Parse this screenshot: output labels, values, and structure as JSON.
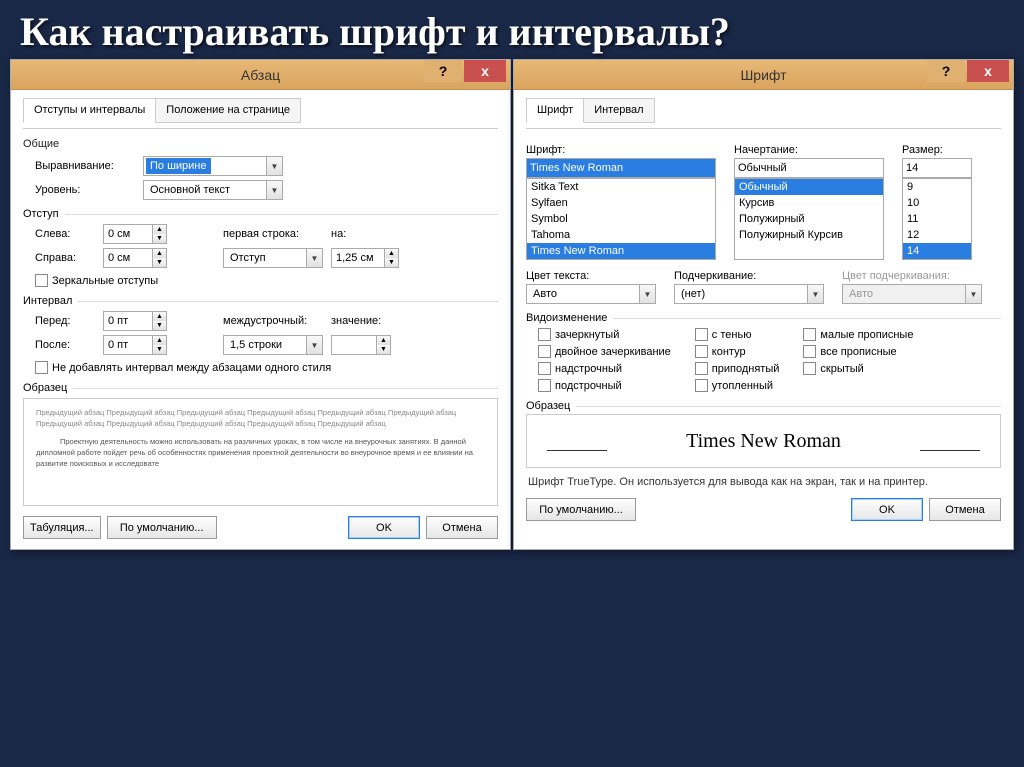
{
  "slide_title": "Как настраивать шрифт и интервалы?",
  "paragraph": {
    "title": "Абзац",
    "help": "?",
    "close": "x",
    "tabs": {
      "t1": "Отступы и интервалы",
      "t2": "Положение на странице"
    },
    "g_general": "Общие",
    "align_label": "Выравнивание:",
    "align_value": "По ширине",
    "level_label": "Уровень:",
    "level_value": "Основной текст",
    "g_indent": "Отступ",
    "left_label": "Слева:",
    "left_value": "0 см",
    "right_label": "Справа:",
    "right_value": "0 см",
    "first_label": "первая строка:",
    "first_value": "Отступ",
    "by_label": "на:",
    "by_value": "1,25 см",
    "mirror": "Зеркальные отступы",
    "g_spacing": "Интервал",
    "before_label": "Перед:",
    "before_value": "0 пт",
    "after_label": "После:",
    "after_value": "0 пт",
    "line_label": "междустрочный:",
    "line_value": "1,5 строки",
    "val_label": "значение:",
    "val_value": "",
    "nospace": "Не добавлять интервал между абзацами одного стиля",
    "g_preview": "Образец",
    "preview_text_1": "Предыдущий абзац Предыдущий абзац Предыдущий абзац Предыдущий абзац Предыдущий абзац Предыдущий абзац Предыдущий абзац Предыдущий абзац Предыдущий абзац Предыдущий абзац Предыдущий абзац",
    "preview_text_2": "Проектную деятельность можно использовать на различных уроках, в том числе на внеурочных занятиях. В данной дипломной работе пойдет речь об особенностях применения проектной деятельности во внеурочное время и ее влиянии на развитие поисковых и исследовате",
    "btn_tabs": "Табуляция...",
    "btn_default": "По умолчанию...",
    "btn_ok": "OK",
    "btn_cancel": "Отмена"
  },
  "font": {
    "title": "Шрифт",
    "help": "?",
    "close": "x",
    "tabs": {
      "t1": "Шрифт",
      "t2": "Интервал"
    },
    "font_label": "Шрифт:",
    "font_value": "Times New Roman",
    "font_list": [
      "Sitka Text",
      "Sylfaen",
      "Symbol",
      "Tahoma",
      "Times New Roman"
    ],
    "style_label": "Начертание:",
    "style_value": "Обычный",
    "style_list": [
      "Обычный",
      "Курсив",
      "Полужирный",
      "Полужирный Курсив"
    ],
    "size_label": "Размер:",
    "size_value": "14",
    "size_list": [
      "9",
      "10",
      "11",
      "12",
      "14"
    ],
    "color_label": "Цвет текста:",
    "color_value": "Авто",
    "underline_label": "Подчеркивание:",
    "underline_value": "(нет)",
    "undercolor_label": "Цвет подчеркивания:",
    "undercolor_value": "Авто",
    "g_effects": "Видоизменение",
    "eff": {
      "strike": "зачеркнутый",
      "dblstrike": "двойное зачеркивание",
      "super": "надстрочный",
      "sub": "подстрочный",
      "shadow": "с тенью",
      "outline": "контур",
      "emboss": "приподнятый",
      "engrave": "утопленный",
      "smallcaps": "малые прописные",
      "allcaps": "все прописные",
      "hidden": "скрытый"
    },
    "g_preview": "Образец",
    "sample_text": "Times New Roman",
    "hint": "Шрифт TrueType. Он используется для вывода как на экран, так и на принтер.",
    "btn_default": "По умолчанию...",
    "btn_ok": "OK",
    "btn_cancel": "Отмена"
  }
}
